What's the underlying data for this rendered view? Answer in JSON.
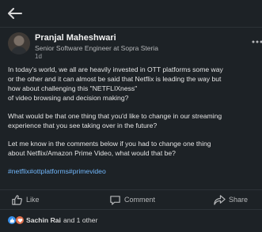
{
  "nav": {
    "back_icon": "arrow-left-icon"
  },
  "author": {
    "name": "Pranjal Maheshwari",
    "headline": "Senior Software Engineer at Sopra Steria",
    "time": "1d"
  },
  "post": {
    "paragraphs": [
      "In today's world, we all are heavily invested in OTT platforms some way\nor the other and it can almost be said that Netflix is leading the way but\nhow about challenging this \"NETFLIXness\"\nof video browsing and decision making?",
      "What would be that one thing that you'd like to change in our streaming\nexperience that you see taking over in the future?",
      "Let me know in the comments below if you had to change one thing\nabout Netflix/Amazon Prime Video, what would that be?"
    ],
    "hashtags": [
      "#netflix",
      "#ottplatforms",
      "#primevideo"
    ]
  },
  "actions": {
    "like": "Like",
    "comment": "Comment",
    "share": "Share"
  },
  "reactions": {
    "name": "Sachin Rai",
    "suffix": "and 1 other"
  },
  "colors": {
    "background": "#1d2226",
    "link": "#71b7fb",
    "like": "#378fe9",
    "heart": "#df704d"
  }
}
